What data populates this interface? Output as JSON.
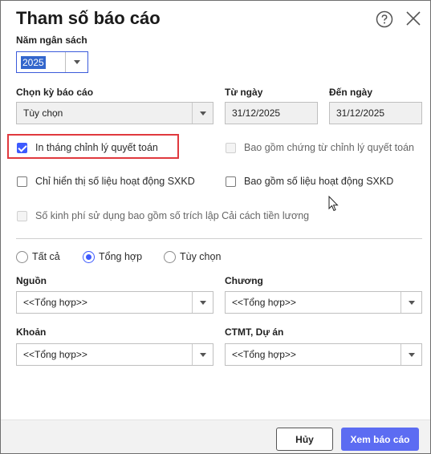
{
  "dialog": {
    "title": "Tham số báo cáo"
  },
  "budget_year": {
    "label": "Năm ngân sách",
    "value": "2025"
  },
  "period": {
    "label": "Chọn kỳ báo cáo",
    "value": "Tùy chọn"
  },
  "from_date": {
    "label": "Từ ngày",
    "value": "31/12/2025"
  },
  "to_date": {
    "label": "Đến ngày",
    "value": "31/12/2025"
  },
  "options": {
    "print_adjust_month": "In tháng chỉnh lý quyết toán",
    "include_adjust_docs": "Bao gồm chứng từ chỉnh lý quyết toán",
    "only_sxkd": "Chỉ hiển thị số liệu hoạt động SXKD",
    "include_sxkd": "Bao gồm số liệu hoạt động SXKD",
    "salary_reform": "Số kinh phí sử dụng bao gồm số trích lập Cải cách tiền lương"
  },
  "mode": {
    "all": "Tất cả",
    "summary": "Tổng hợp",
    "custom": "Tùy chọn",
    "selected": "summary"
  },
  "source": {
    "label": "Nguồn",
    "value": "<<Tổng hợp>>"
  },
  "chapter": {
    "label": "Chương",
    "value": "<<Tổng hợp>>"
  },
  "section": {
    "label": "Khoản",
    "value": "<<Tổng hợp>>"
  },
  "program": {
    "label": "CTMT, Dự án",
    "value": "<<Tổng hợp>>"
  },
  "footer": {
    "cancel": "Hủy",
    "view": "Xem báo cáo"
  },
  "colors": {
    "accent": "#3d5afe",
    "primary_button": "#5c6cf2",
    "highlight": "#e0393e"
  }
}
